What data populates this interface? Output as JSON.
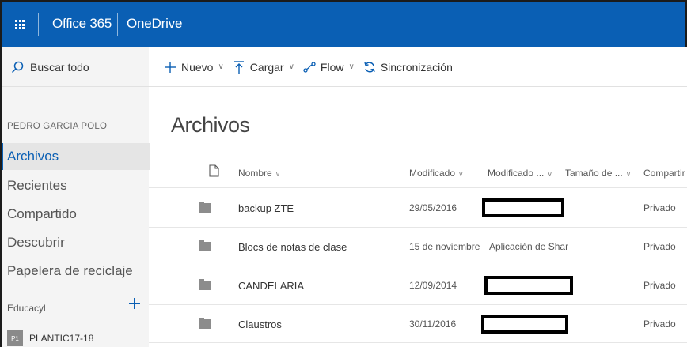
{
  "header": {
    "app_launcher_icon": "waffle-icon",
    "suite_name": "Office 365",
    "app_name": "OneDrive",
    "brand_color": "#0a5fb4"
  },
  "sidebar": {
    "search_placeholder": "Buscar todo",
    "user_name": "PEDRO GARCIA POLO",
    "items": [
      {
        "label": "Archivos",
        "selected": true
      },
      {
        "label": "Recientes",
        "selected": false
      },
      {
        "label": "Compartido",
        "selected": false
      },
      {
        "label": "Descubrir",
        "selected": false
      },
      {
        "label": "Papelera de reciclaje",
        "selected": false
      }
    ],
    "group_label": "Educacyl",
    "group_item": {
      "initials": "P1",
      "name": "PLANTIC17-18"
    }
  },
  "commands": [
    {
      "label": "Nuevo",
      "icon": "plus-icon",
      "dropdown": true
    },
    {
      "label": "Cargar",
      "icon": "upload-icon",
      "dropdown": true
    },
    {
      "label": "Flow",
      "icon": "flow-icon",
      "dropdown": true
    },
    {
      "label": "Sincronización",
      "icon": "sync-icon",
      "dropdown": false
    }
  ],
  "main": {
    "title": "Archivos",
    "columns": {
      "name": "Nombre",
      "modified": "Modificado",
      "modified_by": "Modificado ...",
      "size": "Tamaño de ...",
      "sharing": "Compartir"
    },
    "rows": [
      {
        "name": "backup ZTE",
        "modified": "29/05/2016",
        "modified_by": "",
        "redacted": true,
        "sharing": "Privado"
      },
      {
        "name": "Blocs de notas de clase",
        "modified": "15 de noviembre",
        "modified_by": "Aplicación de Shar",
        "redacted": false,
        "sharing": "Privado"
      },
      {
        "name": "CANDELARIA",
        "modified": "12/09/2014",
        "modified_by": "",
        "redacted": true,
        "sharing": "Privado"
      },
      {
        "name": "Claustros",
        "modified": "30/11/2016",
        "modified_by": "",
        "redacted": true,
        "sharing": "Privado"
      }
    ]
  }
}
